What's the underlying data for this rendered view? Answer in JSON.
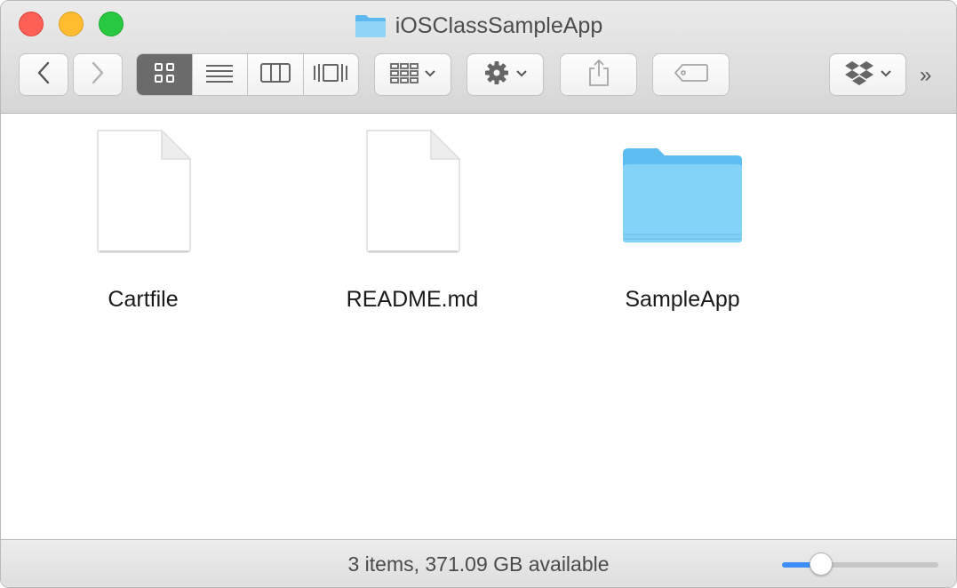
{
  "window": {
    "title": "iOSClassSampleApp",
    "title_icon": "folder-icon"
  },
  "toolbar": {
    "nav": [
      {
        "name": "back",
        "icon": "chevron-left-icon"
      },
      {
        "name": "forward",
        "icon": "chevron-right-icon"
      }
    ],
    "view_modes": [
      {
        "name": "icon-view",
        "icon": "grid-icon",
        "active": true
      },
      {
        "name": "list-view",
        "icon": "list-icon",
        "active": false
      },
      {
        "name": "column-view",
        "icon": "columns-icon",
        "active": false
      },
      {
        "name": "cover-flow-view",
        "icon": "cover-flow-icon",
        "active": false
      }
    ],
    "arrange": {
      "icon": "arrange-icon",
      "has_dropdown": true
    },
    "action": {
      "icon": "gear-icon",
      "has_dropdown": true
    },
    "share": {
      "icon": "share-icon"
    },
    "tags": {
      "icon": "tag-icon"
    },
    "dropbox": {
      "icon": "dropbox-icon",
      "has_dropdown": true
    },
    "overflow_label": "»"
  },
  "items": [
    {
      "name": "Cartfile",
      "kind": "document"
    },
    {
      "name": "README.md",
      "kind": "document"
    },
    {
      "name": "SampleApp",
      "kind": "folder"
    }
  ],
  "status": {
    "text": "3 items, 371.09 GB available",
    "icon_size_fraction": 0.25
  },
  "colors": {
    "accent": "#3d8ef7",
    "folder": "#7ecdf5",
    "close": "#fe5f57",
    "minimize": "#febc2e",
    "zoom": "#28c840"
  }
}
